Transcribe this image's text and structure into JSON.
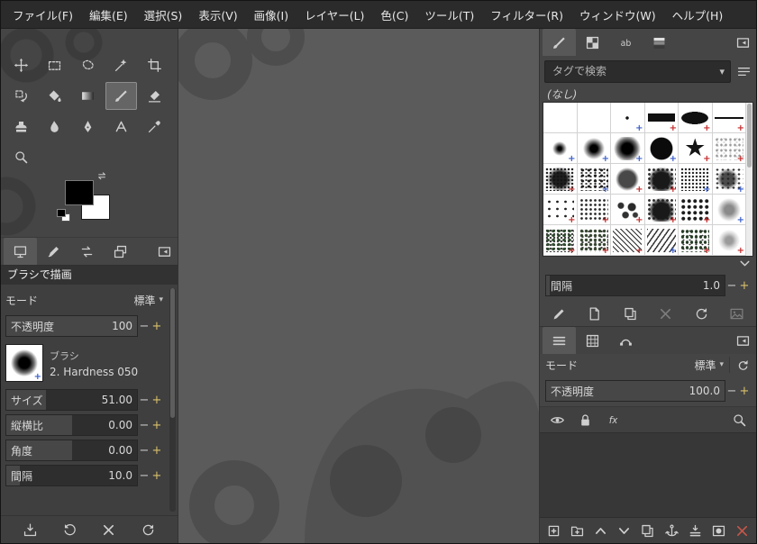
{
  "menubar": {
    "items": [
      "ファイル(F)",
      "編集(E)",
      "選択(S)",
      "表示(V)",
      "画像(I)",
      "レイヤー(L)",
      "色(C)",
      "ツール(T)",
      "フィルター(R)",
      "ウィンドウ(W)",
      "ヘルプ(H)"
    ]
  },
  "toolbox": {
    "tools": [
      "move",
      "rectangle-select",
      "free-select",
      "fuzzy-select",
      "crop",
      "transform",
      "bucket-fill",
      "gradient",
      "paintbrush",
      "eraser",
      "clone",
      "smudge",
      "ink",
      "text",
      "color-picker",
      "zoom"
    ],
    "selected_tool": "paintbrush",
    "foreground_color": "#000000",
    "background_color": "#ffffff",
    "dock_tabs": [
      "tool-options",
      "device-status",
      "undo-history",
      "images"
    ],
    "selected_dock_tab": "tool-options"
  },
  "tool_options": {
    "title": "ブラシで描画",
    "mode": {
      "label": "モード",
      "value": "標準"
    },
    "opacity": {
      "label": "不透明度",
      "value": "100"
    },
    "brush": {
      "label": "ブラシ",
      "value": "2. Hardness 050"
    },
    "sliders": [
      {
        "label": "サイズ",
        "value": "51.00"
      },
      {
        "label": "縦横比",
        "value": "0.00"
      },
      {
        "label": "角度",
        "value": "0.00"
      },
      {
        "label": "間隔",
        "value": "10.0"
      }
    ],
    "footer_buttons": [
      "save-tool-preset",
      "restore-tool-preset",
      "delete-tool-preset",
      "reset-tool-options"
    ]
  },
  "brushes_dock": {
    "tabs": [
      "brushes",
      "patterns",
      "fonts",
      "gradients"
    ],
    "selected_tab": "brushes",
    "search_placeholder": "タグで検索",
    "selected_tag": "(なし)",
    "spacing": {
      "label": "間隔",
      "value": "1.0"
    },
    "action_buttons": [
      "edit-brush",
      "new-brush",
      "duplicate-brush",
      "delete-brush",
      "refresh-brushes",
      "open-brush-as-image"
    ],
    "grid": [
      {
        "type": "blank",
        "badge": "none"
      },
      {
        "type": "blank",
        "badge": "none"
      },
      {
        "type": "pixel-dot",
        "badge": "blue"
      },
      {
        "type": "block-bar",
        "badge": "red"
      },
      {
        "type": "block-ellipse",
        "badge": "red"
      },
      {
        "type": "thin-line",
        "badge": "red"
      },
      {
        "type": "soft-small",
        "badge": "blue"
      },
      {
        "type": "soft-medium",
        "badge": "blue"
      },
      {
        "type": "soft-large",
        "badge": "blue"
      },
      {
        "type": "hard-circle",
        "badge": "blue"
      },
      {
        "type": "star",
        "badge": "red"
      },
      {
        "type": "splatter-light",
        "badge": "red"
      },
      {
        "type": "texture-dense",
        "badge": "red"
      },
      {
        "type": "texture-splatter",
        "badge": "blue"
      },
      {
        "type": "texture-chalk",
        "badge": "red"
      },
      {
        "type": "texture-blob",
        "badge": "red"
      },
      {
        "type": "texture-speckle",
        "badge": "blue"
      },
      {
        "type": "texture-grunge",
        "badge": "blue"
      },
      {
        "type": "speckle-sparse",
        "badge": "red"
      },
      {
        "type": "speckle-cluster",
        "badge": "red"
      },
      {
        "type": "texture-cells",
        "badge": "red"
      },
      {
        "type": "texture-blob2",
        "badge": "red"
      },
      {
        "type": "grid-dots",
        "badge": "red"
      },
      {
        "type": "soft-gray",
        "badge": "blue"
      },
      {
        "type": "texture-vine",
        "badge": "red"
      },
      {
        "type": "texture-moss",
        "badge": "red"
      },
      {
        "type": "texture-hatch",
        "badge": "red"
      },
      {
        "type": "texture-strokes",
        "badge": "blue"
      },
      {
        "type": "texture-grass",
        "badge": "red"
      },
      {
        "type": "texture-smoke",
        "badge": "red"
      }
    ]
  },
  "layers_dock": {
    "tabs": [
      "layers",
      "channels",
      "paths"
    ],
    "selected_tab": "layers",
    "mode": {
      "label": "モード",
      "value": "標準"
    },
    "opacity": {
      "label": "不透明度",
      "value": "100.0"
    },
    "action_buttons": [
      "new-layer",
      "new-layer-group",
      "raise-layer",
      "lower-layer",
      "duplicate-layer",
      "anchor-layer",
      "merge-down",
      "add-layer-mask",
      "delete-layer"
    ]
  },
  "colors": {
    "badge_red": "#c22a2a",
    "badge_blue": "#3a5fc8",
    "delete_accent": "#c4574a",
    "spin_plus": "#d9c06a"
  }
}
